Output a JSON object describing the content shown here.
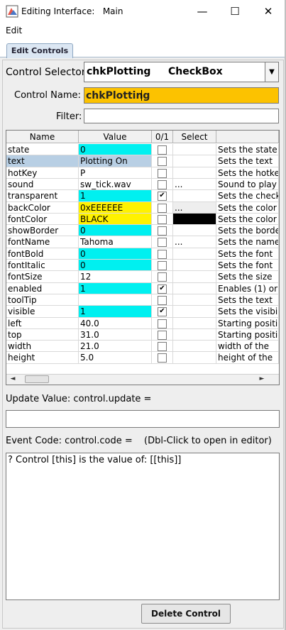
{
  "window": {
    "title": "Editing Interface:   Main",
    "minimize_glyph": "—",
    "maximize_glyph": "☐",
    "close_glyph": "✕"
  },
  "menu": {
    "edit": "Edit"
  },
  "tab": {
    "label": "Edit Controls"
  },
  "selector": {
    "label": "Control Selector:",
    "control_name": "chkPlotting",
    "control_type": "CheckBox",
    "arrow": "▼"
  },
  "name_field": {
    "label": "Control Name:",
    "value": "chkPlotting"
  },
  "filter": {
    "label": "Filter:",
    "value": ""
  },
  "table": {
    "headers": [
      "Name",
      "Value",
      "0/1",
      "Select",
      ""
    ],
    "rows": [
      {
        "name": "state",
        "value": "0",
        "checked": false,
        "select": "",
        "desc": "Sets the state",
        "value_color": "#00f0f0",
        "select_color": "#ffffff"
      },
      {
        "name": "text",
        "value": "Plotting On",
        "checked": false,
        "select": "",
        "desc": "Sets the text",
        "value_color": "#b8cfe4",
        "select_color": "#ffffff"
      },
      {
        "name": "hotKey",
        "value": "P",
        "checked": false,
        "select": "",
        "desc": "Sets the hotkey",
        "value_color": "#ffffff",
        "select_color": "#ffffff"
      },
      {
        "name": "sound",
        "value": "sw_tick.wav",
        "checked": false,
        "select": "...",
        "desc": "Sound to play",
        "value_color": "#ffffff",
        "select_color": "#ffffff"
      },
      {
        "name": "transparent",
        "value": "1",
        "checked": true,
        "select": "",
        "desc": "Sets the check",
        "value_color": "#00f0f0",
        "select_color": "#ffffff"
      },
      {
        "name": "backColor",
        "value": "0xEEEEEE",
        "checked": false,
        "select": "...",
        "desc": "Sets the color",
        "value_color": "#fff200",
        "select_color": "#eeeeee"
      },
      {
        "name": "fontColor",
        "value": "BLACK",
        "checked": false,
        "select": "...",
        "desc": "Sets the color",
        "value_color": "#fff200",
        "select_color": "#000000"
      },
      {
        "name": "showBorder",
        "value": "0",
        "checked": false,
        "select": "",
        "desc": "Sets the border",
        "value_color": "#00f0f0",
        "select_color": "#ffffff"
      },
      {
        "name": "fontName",
        "value": "Tahoma",
        "checked": false,
        "select": "...",
        "desc": "Sets the name",
        "value_color": "#ffffff",
        "select_color": "#ffffff"
      },
      {
        "name": "fontBold",
        "value": "0",
        "checked": false,
        "select": "",
        "desc": "Sets the font",
        "value_color": "#00f0f0",
        "select_color": "#ffffff"
      },
      {
        "name": "fontItalic",
        "value": "0",
        "checked": false,
        "select": "",
        "desc": "Sets the font",
        "value_color": "#00f0f0",
        "select_color": "#ffffff"
      },
      {
        "name": "fontSize",
        "value": "12",
        "checked": false,
        "select": "",
        "desc": "Sets the size",
        "value_color": "#ffffff",
        "select_color": "#ffffff"
      },
      {
        "name": "enabled",
        "value": "1",
        "checked": true,
        "select": "",
        "desc": "Enables (1) or",
        "value_color": "#00f0f0",
        "select_color": "#ffffff"
      },
      {
        "name": "toolTip",
        "value": "",
        "checked": false,
        "select": "",
        "desc": "Sets the text",
        "value_color": "#ffffff",
        "select_color": "#ffffff"
      },
      {
        "name": "visible",
        "value": "1",
        "checked": true,
        "select": "",
        "desc": "Sets the visibility",
        "value_color": "#00f0f0",
        "select_color": "#ffffff"
      },
      {
        "name": "left",
        "value": "40.0",
        "checked": false,
        "select": "",
        "desc": "Starting position",
        "value_color": "#ffffff",
        "select_color": "#ffffff"
      },
      {
        "name": "top",
        "value": "31.0",
        "checked": false,
        "select": "",
        "desc": "Starting position",
        "value_color": "#ffffff",
        "select_color": "#ffffff"
      },
      {
        "name": "width",
        "value": "21.0",
        "checked": false,
        "select": "",
        "desc": "width of the",
        "value_color": "#ffffff",
        "select_color": "#ffffff"
      },
      {
        "name": "height",
        "value": "5.0",
        "checked": false,
        "select": "",
        "desc": "height of the",
        "value_color": "#ffffff",
        "select_color": "#ffffff"
      }
    ]
  },
  "scroll": {
    "left_glyph": "◄",
    "right_glyph": "►"
  },
  "update": {
    "label": "Update Value: control.update =",
    "value": ""
  },
  "event": {
    "label": "Event Code: control.code =",
    "hint": "(Dbl-Click to open in editor)",
    "code": "? Control [this] is the value of: [[this]]"
  },
  "delete_button": "Delete Control"
}
